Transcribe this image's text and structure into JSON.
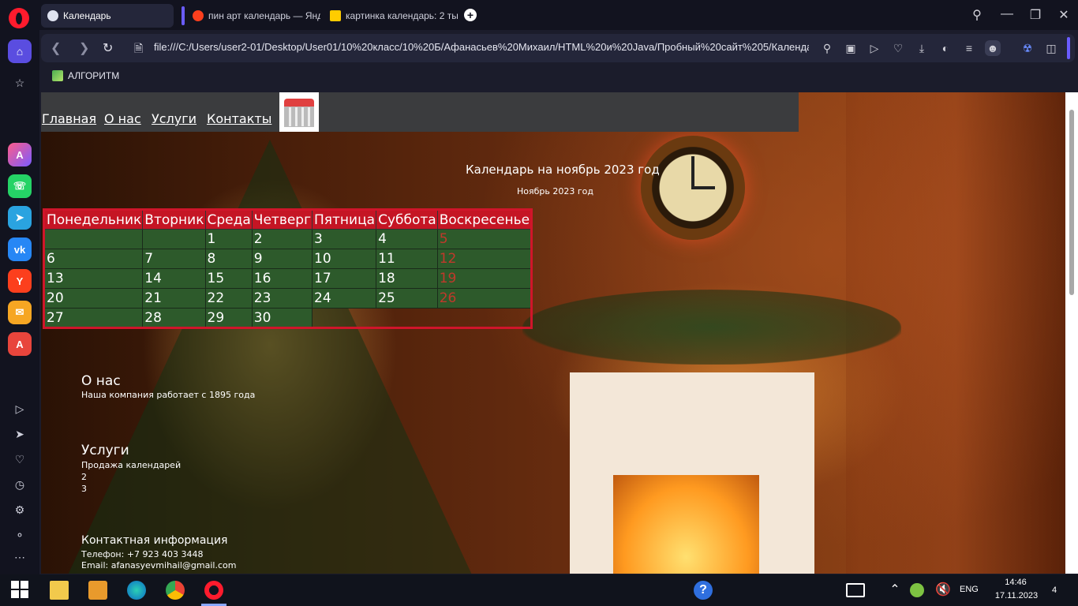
{
  "browser": {
    "tabs": [
      {
        "label": "Календарь",
        "active": true
      },
      {
        "label": "пин арт календарь — Янд",
        "active": false
      },
      {
        "label": "картинка календарь: 2 ты",
        "active": false
      }
    ],
    "new_tab_label": "+",
    "address": "file:///C:/Users/user2-01/Desktop/User01/10%20класс/10%20Б/Афанасьев%20Михаил/HTML%20и%20Java/Пробный%20сайт%205/Календа",
    "bookmarks": [
      {
        "label": "АЛГОРИТМ"
      }
    ],
    "accent_color": "#5a4de0"
  },
  "sidebar_apps": [
    "aria",
    "whatsapp",
    "telegram",
    "vk",
    "yandex",
    "mail",
    "translate"
  ],
  "site": {
    "nav": [
      "Главная",
      "О нас",
      "Услуги",
      "Контакты"
    ],
    "heading": "Календарь на ноябрь 2023 год",
    "caption": "Ноябрь 2023 год",
    "calendar": {
      "weekdays": [
        "Понедельник",
        "Вторник",
        "Среда",
        "Четверг",
        "Пятница",
        "Суббота",
        "Воскресенье"
      ],
      "weeks": [
        [
          "",
          "",
          "1",
          "2",
          "3",
          "4",
          "5"
        ],
        [
          "6",
          "7",
          "8",
          "9",
          "10",
          "11",
          "12"
        ],
        [
          "13",
          "14",
          "15",
          "16",
          "17",
          "18",
          "19"
        ],
        [
          "20",
          "21",
          "22",
          "23",
          "24",
          "25",
          "26"
        ],
        [
          "27",
          "28",
          "29",
          "30",
          "",
          "",
          ""
        ]
      ],
      "header_color": "#c51524",
      "cell_color": "#2d5a2b",
      "sunday_color": "#c0392b"
    },
    "about": {
      "title": "О нас",
      "text": "Наша компания работает с 1895 года"
    },
    "services": {
      "title": "Услуги",
      "items": [
        "Продажа календарей",
        "2",
        "3"
      ]
    },
    "contacts": {
      "title": "Контактная информация",
      "phone": "Телефон: +7 923 403 3448",
      "email": "Email: afanasyevmihail@gmail.com"
    }
  },
  "taskbar": {
    "time": "14:46",
    "date": "17.11.2023",
    "language": "ENG",
    "notifications": "4"
  }
}
